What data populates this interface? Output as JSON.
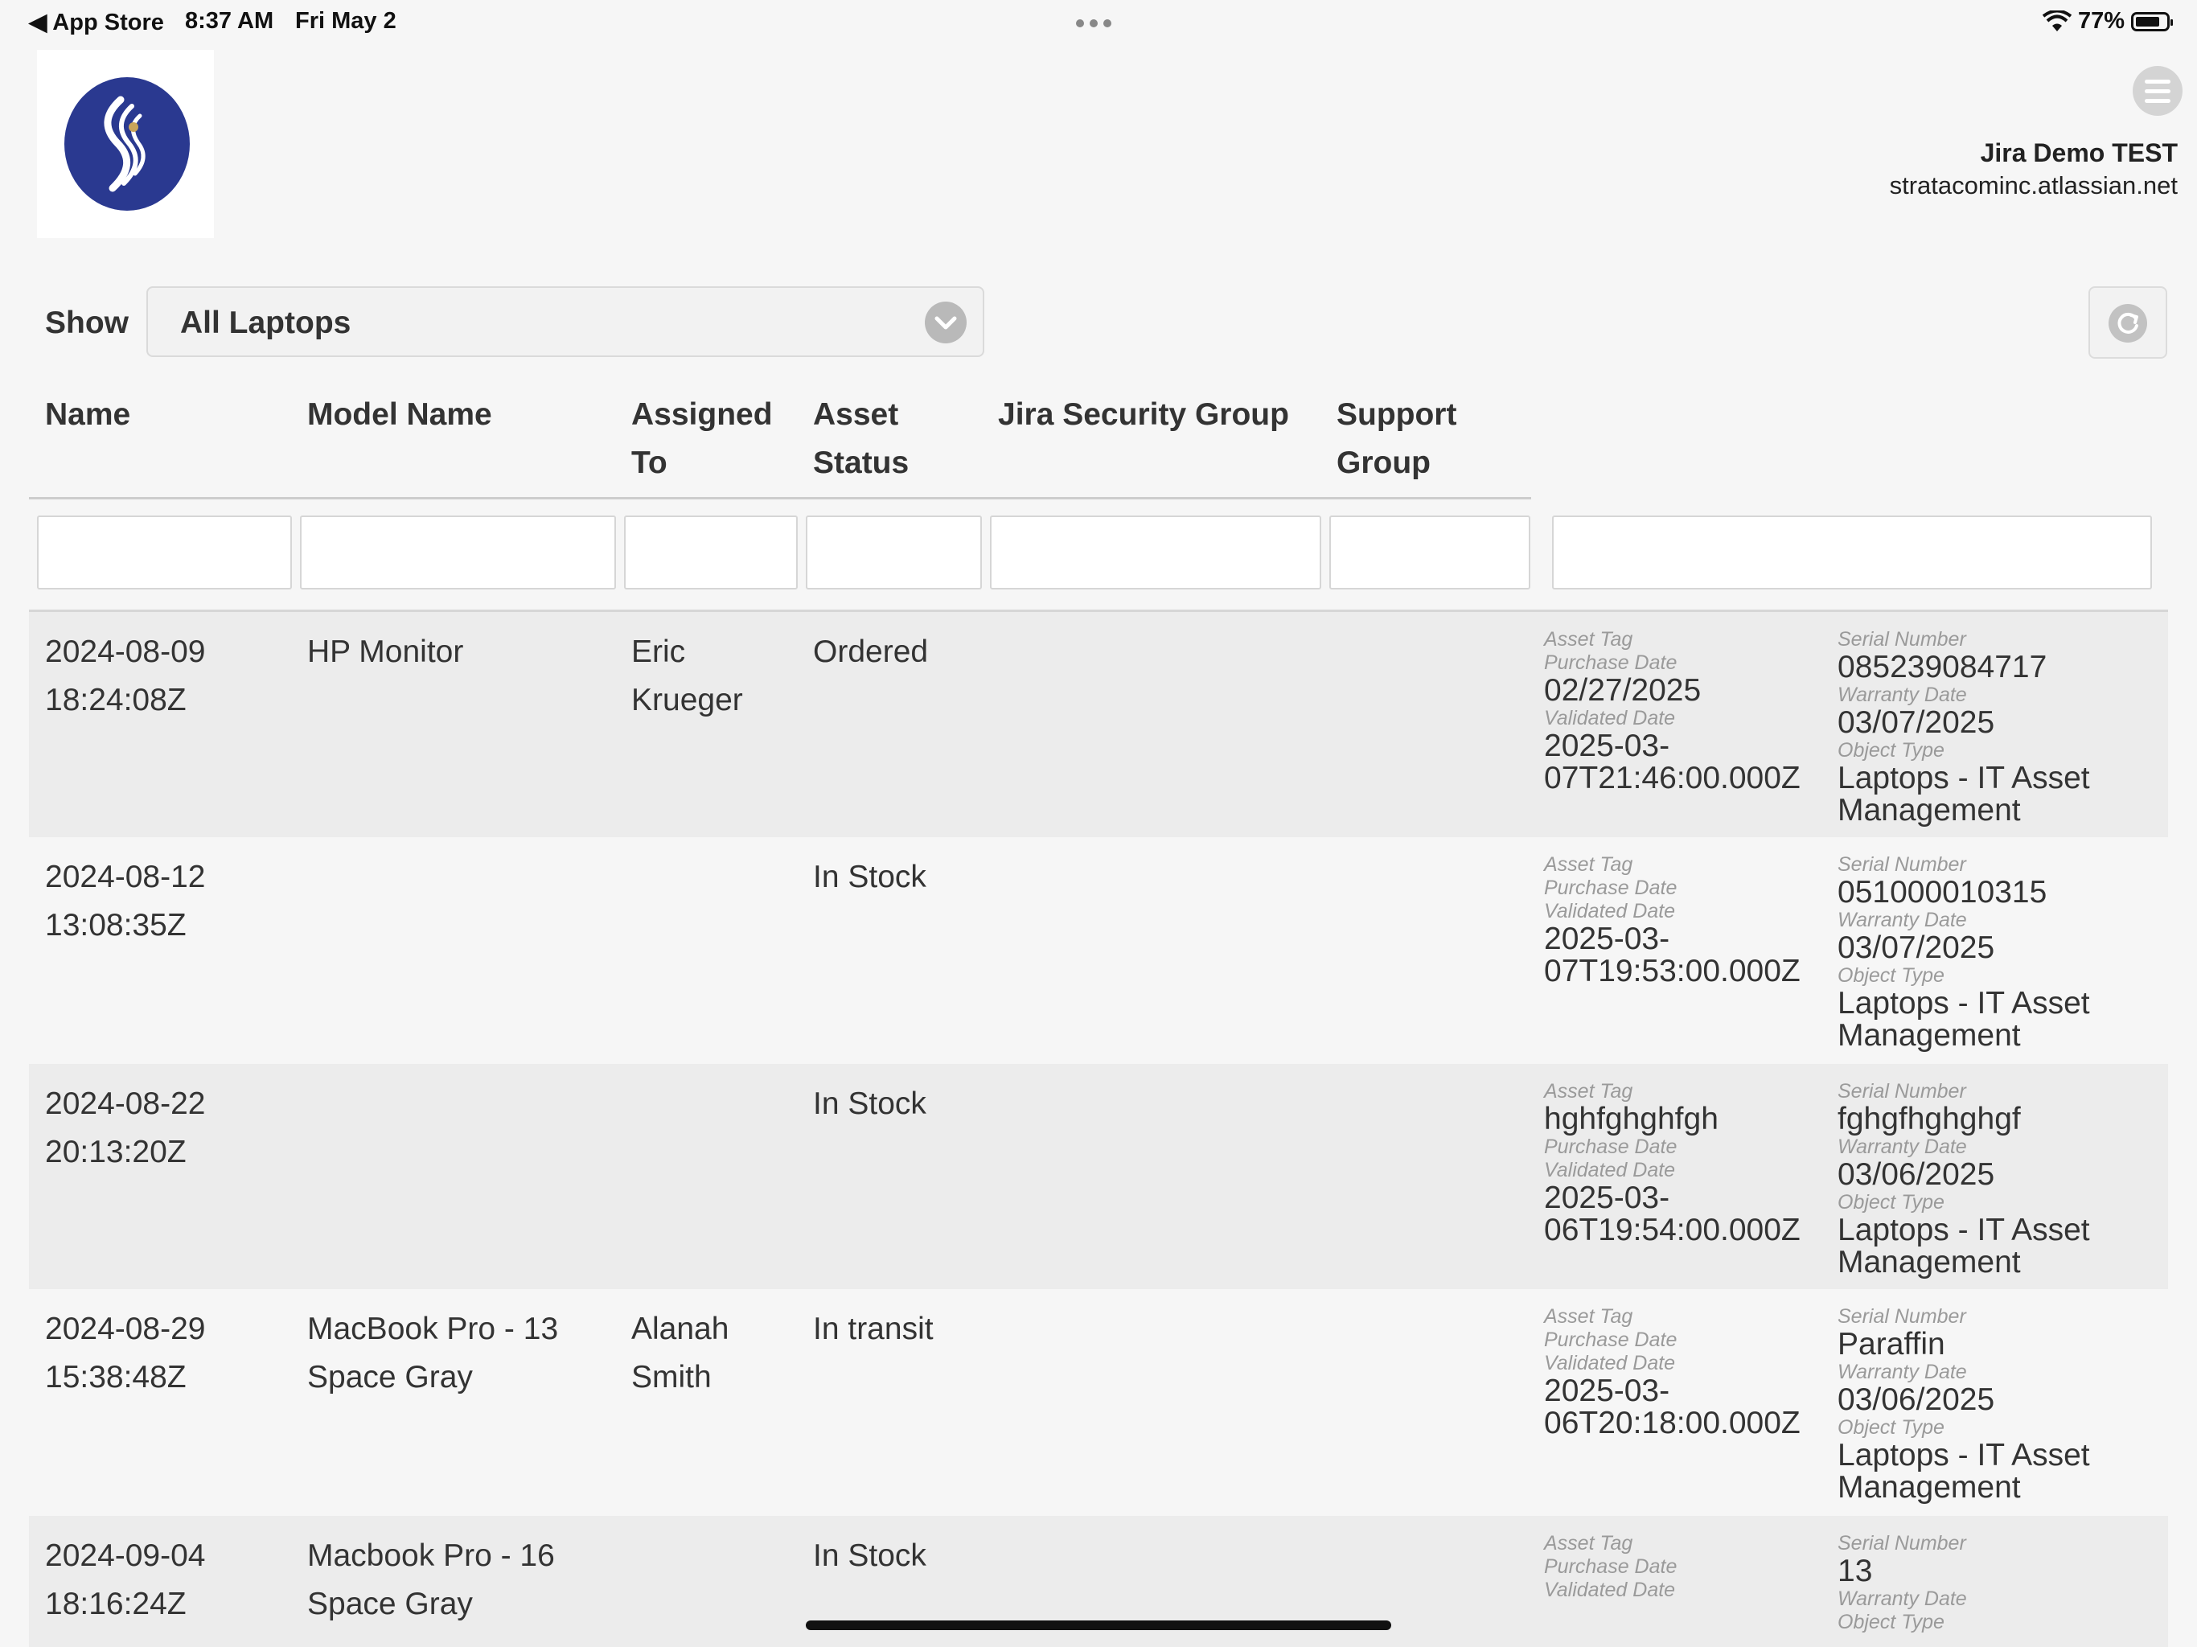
{
  "status_bar": {
    "back_label": "App Store",
    "time": "8:37 AM",
    "date": "Fri May 2",
    "battery": "77%"
  },
  "header": {
    "org_name": "Jira Demo TEST",
    "org_url": "stratacominc.atlassian.net"
  },
  "filter": {
    "show_label": "Show",
    "selected_view": "All Laptops"
  },
  "table": {
    "columns": {
      "name": "Name",
      "model_name": "Model Name",
      "assigned_to": "Assigned\nTo",
      "asset_status": "Asset\nStatus",
      "jira_security_group": "Jira Security Group",
      "support_group": "Support\nGroup"
    },
    "detail_labels": {
      "asset_tag": "Asset Tag",
      "purchase_date": "Purchase Date",
      "validated_date": "Validated Date",
      "serial_number": "Serial Number",
      "warranty_date": "Warranty Date",
      "object_type": "Object Type"
    },
    "rows": [
      {
        "name": "2024-08-09\n18:24:08Z",
        "model_name": "HP Monitor",
        "assigned_to": "Eric\nKrueger",
        "asset_status": "Ordered",
        "asset_tag": "",
        "purchase_date": "02/27/2025",
        "validated_date": "2025-03-\n07T21:46:00.000Z",
        "serial_number": "085239084717",
        "warranty_date": "03/07/2025",
        "object_type": "Laptops - IT Asset\nManagement"
      },
      {
        "name": "2024-08-12\n13:08:35Z",
        "model_name": "",
        "assigned_to": "",
        "asset_status": "In Stock",
        "asset_tag": "",
        "purchase_date": "",
        "validated_date": "2025-03-\n07T19:53:00.000Z",
        "serial_number": "051000010315",
        "warranty_date": "03/07/2025",
        "object_type": "Laptops - IT Asset\nManagement"
      },
      {
        "name": "2024-08-22\n20:13:20Z",
        "model_name": "",
        "assigned_to": "",
        "asset_status": "In Stock",
        "asset_tag": "hghfghghfgh",
        "purchase_date": "",
        "validated_date": "2025-03-\n06T19:54:00.000Z",
        "serial_number": "fghgfhghghgf",
        "warranty_date": "03/06/2025",
        "object_type": "Laptops - IT Asset\nManagement"
      },
      {
        "name": "2024-08-29\n15:38:48Z",
        "model_name": "MacBook Pro - 13\nSpace Gray",
        "assigned_to": "Alanah\nSmith",
        "asset_status": "In transit",
        "asset_tag": "",
        "purchase_date": "",
        "validated_date": "2025-03-\n06T20:18:00.000Z",
        "serial_number": "Paraffin",
        "warranty_date": "03/06/2025",
        "object_type": "Laptops - IT Asset\nManagement"
      },
      {
        "name": "2024-09-04\n18:16:24Z",
        "model_name": "Macbook Pro - 16\nSpace Gray",
        "assigned_to": "",
        "asset_status": "In Stock",
        "asset_tag": "",
        "purchase_date": "",
        "validated_date": "",
        "serial_number": "13",
        "warranty_date": "",
        "object_type": ""
      }
    ]
  }
}
